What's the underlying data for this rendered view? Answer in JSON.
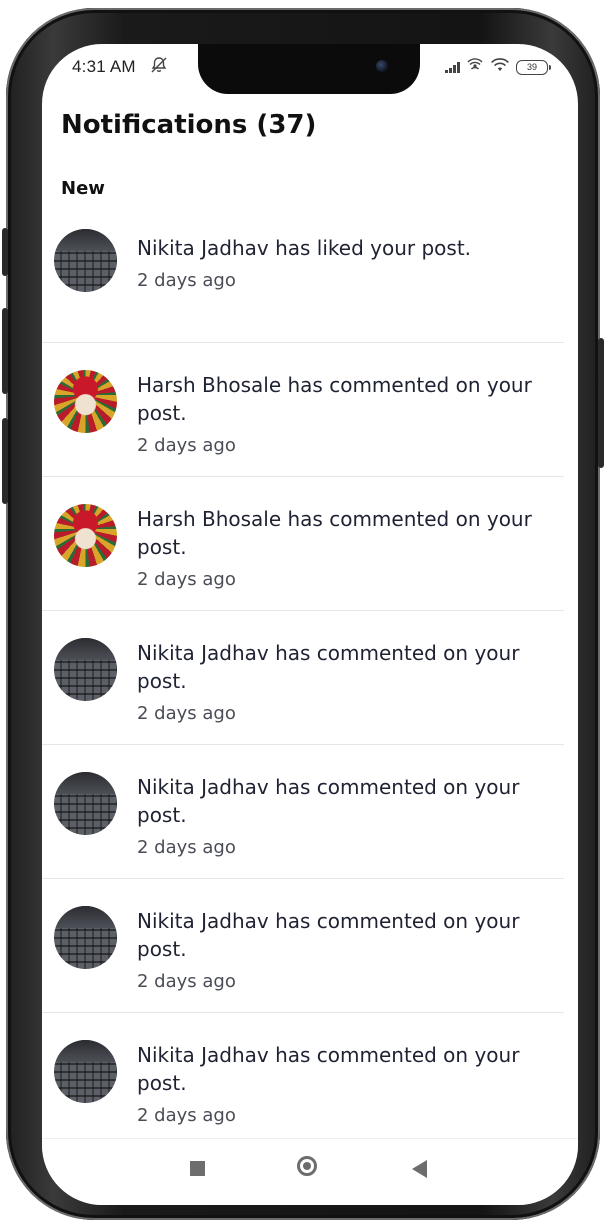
{
  "status_bar": {
    "time": "4:31 AM",
    "battery": "39"
  },
  "header": {
    "title": "Notifications (37)"
  },
  "section": {
    "label": "New"
  },
  "notifications": [
    {
      "message": "Nikita Jadhav has liked your post.",
      "time": "2 days ago",
      "avatar": "keyboard"
    },
    {
      "message": "Harsh Bhosale has commented on your post.",
      "time": "2 days ago",
      "avatar": "deity"
    },
    {
      "message": "Harsh Bhosale has commented on your post.",
      "time": "2 days ago",
      "avatar": "deity"
    },
    {
      "message": "Nikita Jadhav has commented on your post.",
      "time": "2 days ago",
      "avatar": "keyboard"
    },
    {
      "message": "Nikita Jadhav has commented on your post.",
      "time": "2 days ago",
      "avatar": "keyboard"
    },
    {
      "message": "Nikita Jadhav has commented on your post.",
      "time": "2 days ago",
      "avatar": "keyboard"
    },
    {
      "message": "Nikita Jadhav has commented on your post.",
      "time": "2 days ago",
      "avatar": "keyboard"
    }
  ],
  "icons": {
    "status_mute": "bell-off-icon",
    "status_signal": "signal-icon",
    "status_hotspot": "hotspot-icon",
    "status_wifi": "wifi-icon",
    "nav_recents": "square-icon",
    "nav_home": "circle-icon",
    "nav_back": "back-triangle-icon"
  }
}
